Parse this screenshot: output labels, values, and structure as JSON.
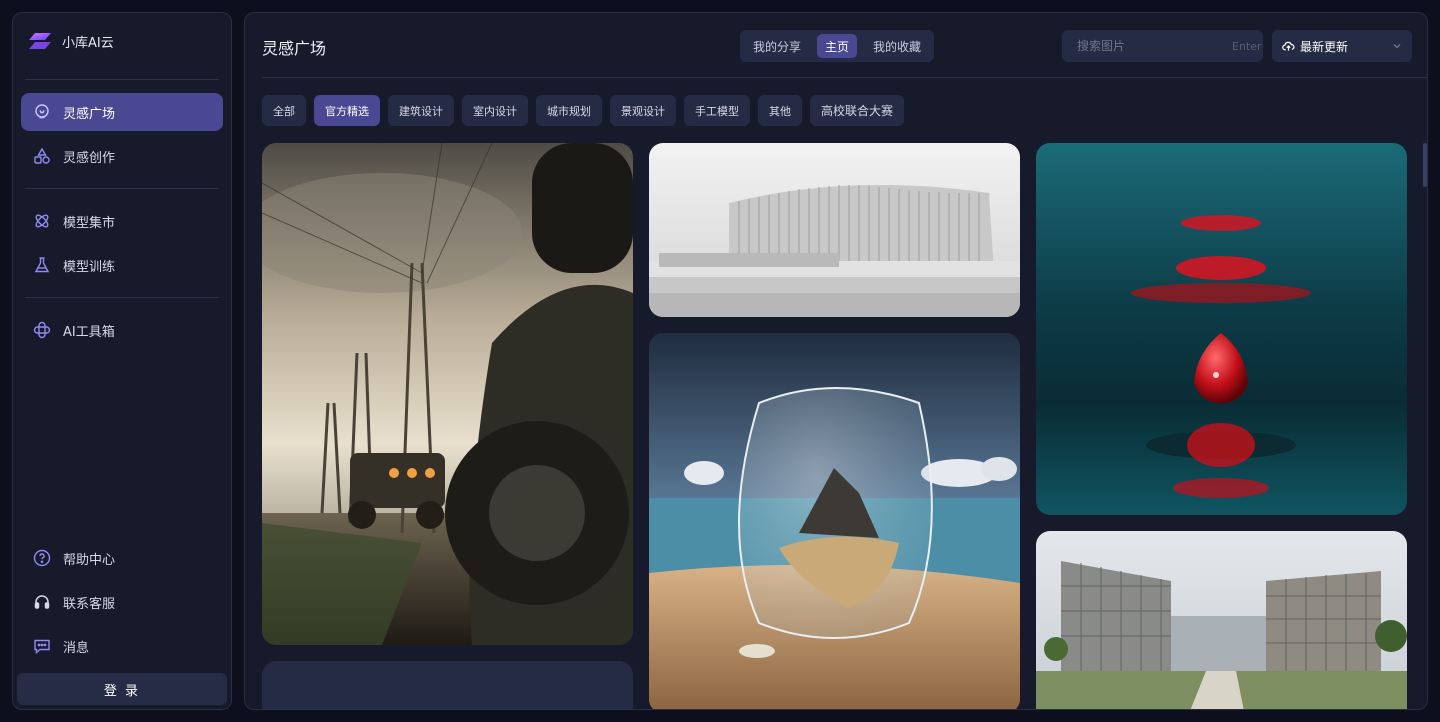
{
  "brand": {
    "name": "小库AI云"
  },
  "sidebar": {
    "items": [
      {
        "label": "灵感广场",
        "icon": "lightbulb-icon"
      },
      {
        "label": "灵感创作",
        "icon": "shapes-icon"
      },
      {
        "label": "模型集市",
        "icon": "atom-icon"
      },
      {
        "label": "模型训练",
        "icon": "flask-icon"
      },
      {
        "label": "AI工具箱",
        "icon": "toolbox-icon"
      }
    ],
    "bottom_items": [
      {
        "label": "帮助中心",
        "icon": "help-icon"
      },
      {
        "label": "联系客服",
        "icon": "headset-icon"
      },
      {
        "label": "消息",
        "icon": "message-icon"
      }
    ],
    "login_label": "登 录"
  },
  "header": {
    "title": "灵感广场",
    "tabs": [
      "我的分享",
      "主页",
      "我的收藏"
    ],
    "active_tab": "主页",
    "search": {
      "placeholder": "搜索图片",
      "hint": "Enter"
    },
    "sort_label": "最新更新"
  },
  "categories": [
    "全部",
    "官方精选",
    "建筑设计",
    "室内设计",
    "城市规划",
    "景观设计",
    "手工模型",
    "其他",
    "高校联合大赛"
  ],
  "active_category": "官方精选",
  "gallery": [
    {
      "subject": "off-road vehicle under power lines"
    },
    {
      "subject": "white concert hall building"
    },
    {
      "subject": "island inside glass on beach"
    },
    {
      "subject": "red water droplet"
    },
    {
      "subject": "glass office campus"
    }
  ],
  "colors": {
    "accent": "#4b4893",
    "panel": "#161a2b",
    "control": "#262b45",
    "background": "#0d0f1c"
  }
}
